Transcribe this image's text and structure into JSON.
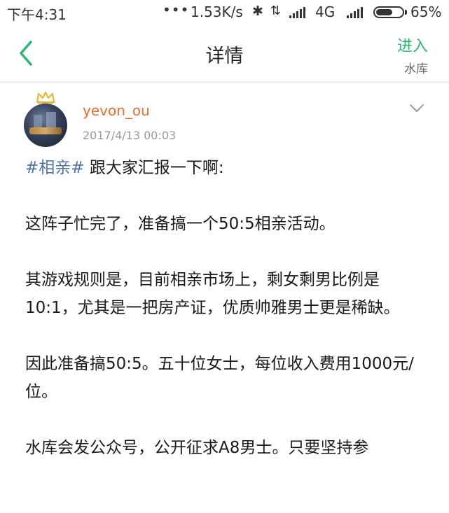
{
  "status_bar": {
    "time": "下午4:31",
    "dots": "•••",
    "speed": "1.53K/s",
    "bluetooth_icon": "bluetooth-icon",
    "data_icon": "data-transfer-icon",
    "network": "4G",
    "battery_pct": "65%",
    "battery_level": 0.65
  },
  "nav": {
    "title": "详情",
    "enter_label": "进入",
    "enter_sub": "水库"
  },
  "post": {
    "username": "yevon_ou",
    "time": "2017/4/13 00:03",
    "hashtag": "#相亲#",
    "intro": " 跟大家汇报一下啊:",
    "paragraphs": [
      "这阵子忙完了，准备搞一个50:5相亲活动。",
      "其游戏规则是，目前相亲市场上，剩女剩男比例是10:1，尤其是一把房产证，优质帅雅男士更是稀缺。",
      "因此准备搞50:5。五十位女士，每位收入费用1000元/位。",
      "水库会发公众号，公开征求A8男士。只要坚持参"
    ]
  },
  "colors": {
    "accent": "#2bb673",
    "username": "#e86c2c",
    "hashtag": "#4f75a8",
    "meta": "#9a9a9a"
  }
}
